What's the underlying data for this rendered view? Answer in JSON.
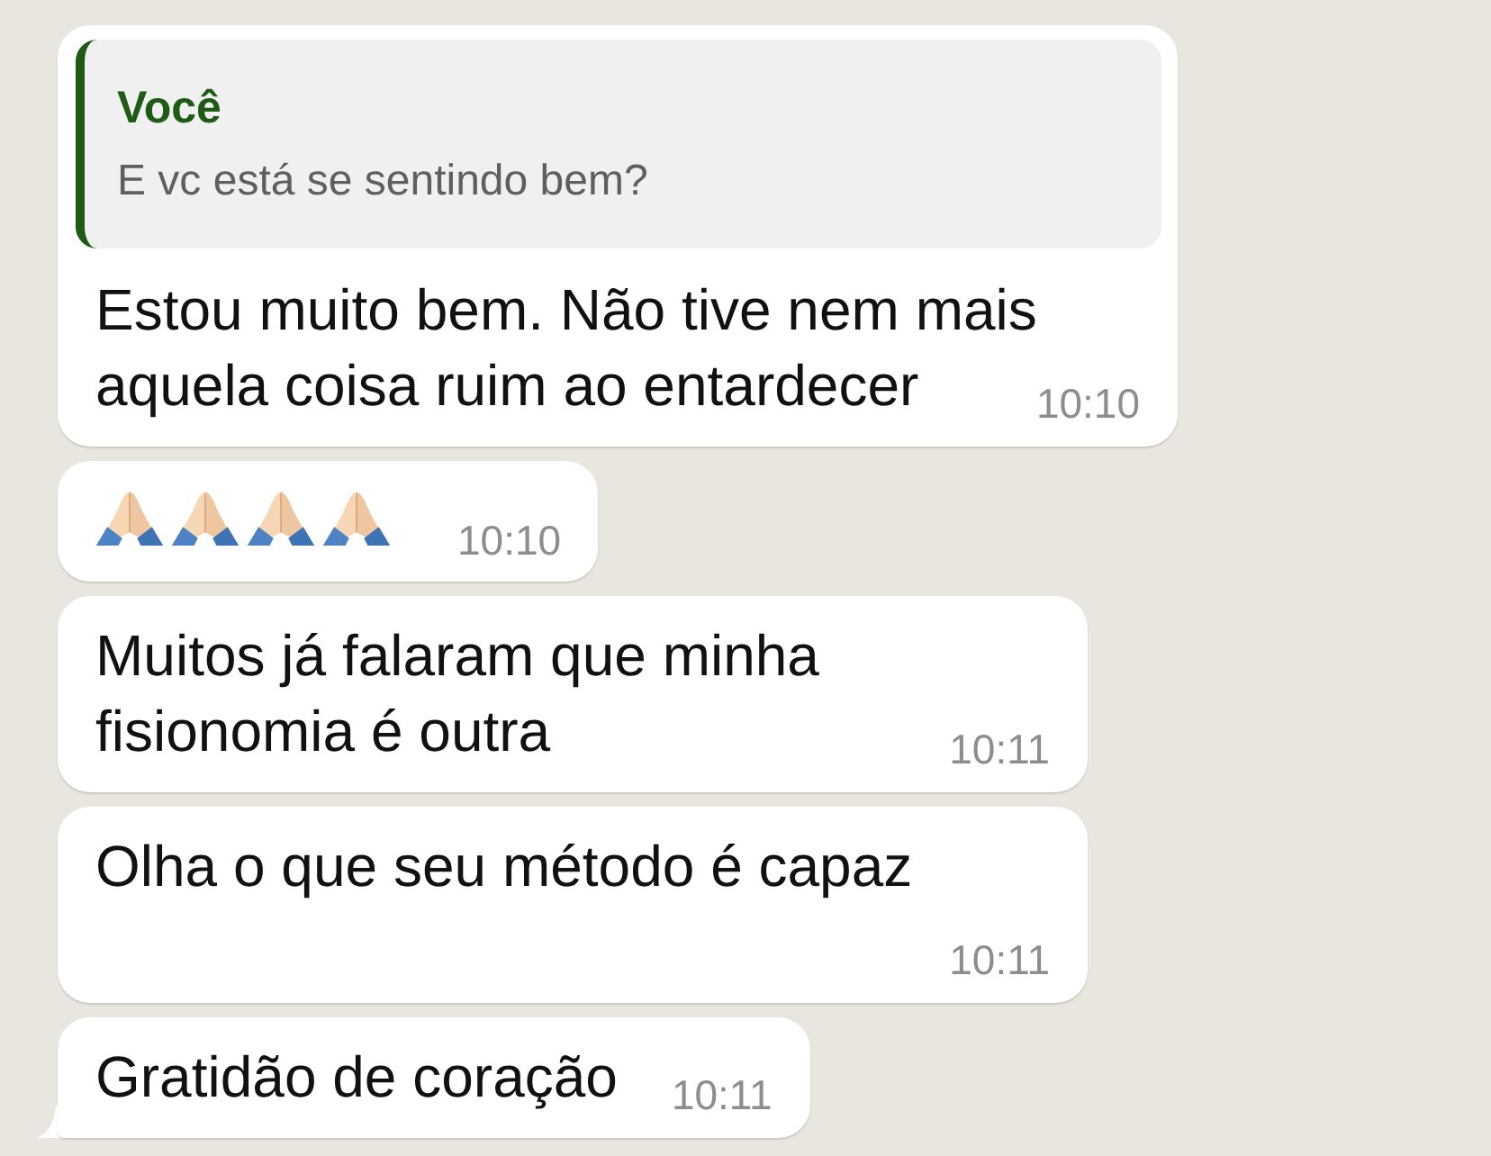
{
  "messages": [
    {
      "kind": "reply",
      "quote": {
        "author": "Você",
        "text": "E vc está se sentindo bem?"
      },
      "text": "Estou muito bem. Não tive nem mais aquela coisa ruim ao entardecer",
      "time": "10:10",
      "tail": false
    },
    {
      "kind": "emoji",
      "emojis": [
        {
          "kind": "praying-hands"
        },
        {
          "kind": "praying-hands"
        },
        {
          "kind": "praying-hands"
        },
        {
          "kind": "praying-hands"
        }
      ],
      "time": "10:10",
      "tail": false
    },
    {
      "kind": "text",
      "text": "Muitos já falaram que minha fisionomia é outra",
      "time": "10:11",
      "tail": false
    },
    {
      "kind": "text",
      "text": "Olha o que seu método é capaz",
      "time": "10:11",
      "tail": false
    },
    {
      "kind": "text",
      "text": "Gratidão de coração",
      "time": "10:11",
      "tail": true
    }
  ]
}
